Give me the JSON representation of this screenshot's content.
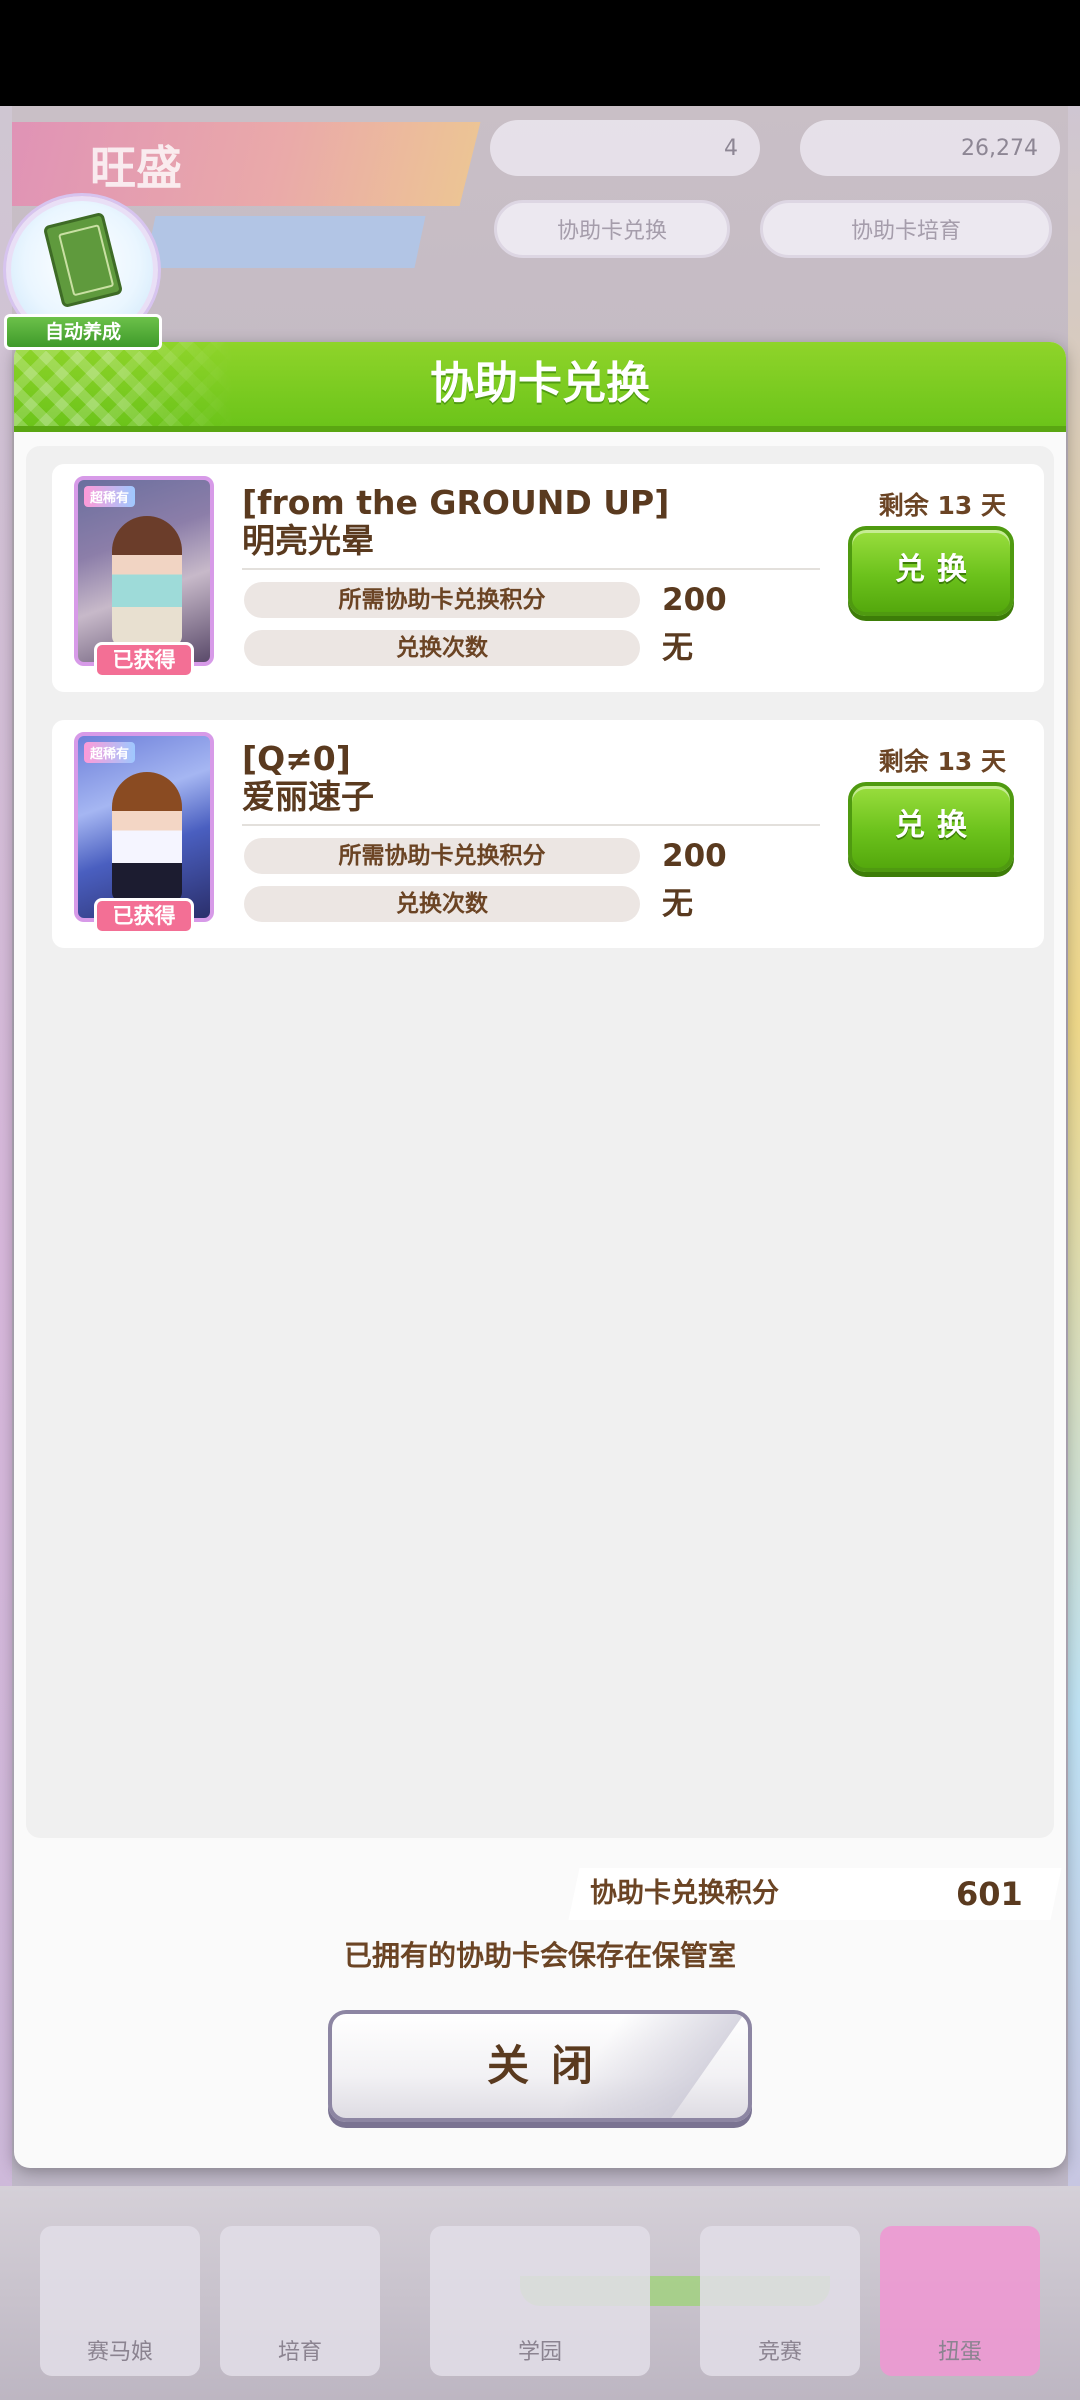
{
  "background": {
    "title": "旺盛",
    "currency_1": "4",
    "currency_2": "26,274",
    "pill_left": "协助卡兑换",
    "pill_right": "协助卡培育",
    "nav": [
      "赛马娘",
      "培育",
      "学园",
      "竞赛",
      "扭蛋"
    ]
  },
  "auto_badge": {
    "label": "自动养成",
    "icon": "book-icon"
  },
  "modal": {
    "title": "协助卡兑换",
    "items": [
      {
        "title_line1": "[from the GROUND UP]",
        "title_line2": "明亮光晕",
        "rarity": "超稀有",
        "owned_label": "已获得",
        "remaining": "剩余 13 天",
        "points_label": "所需协助卡兑换积分",
        "points_value": "200",
        "count_label": "兑换次数",
        "count_value": "无",
        "button_label": "兑换"
      },
      {
        "title_line1": "[Q≠0]",
        "title_line2": "爱丽速子",
        "rarity": "超稀有",
        "owned_label": "已获得",
        "remaining": "剩余 13 天",
        "points_label": "所需协助卡兑换积分",
        "points_value": "200",
        "count_label": "兑换次数",
        "count_value": "无",
        "button_label": "兑换"
      }
    ],
    "footer": {
      "points_label": "协助卡兑换积分",
      "points_value": "601",
      "note": "已拥有的协助卡会保存在保管室",
      "close_label": "关闭"
    }
  },
  "colors": {
    "header_green": "#7cca22",
    "text_brown": "#5a3a1f",
    "owned_pink": "#f36f95",
    "button_green": "#6cc21c"
  }
}
